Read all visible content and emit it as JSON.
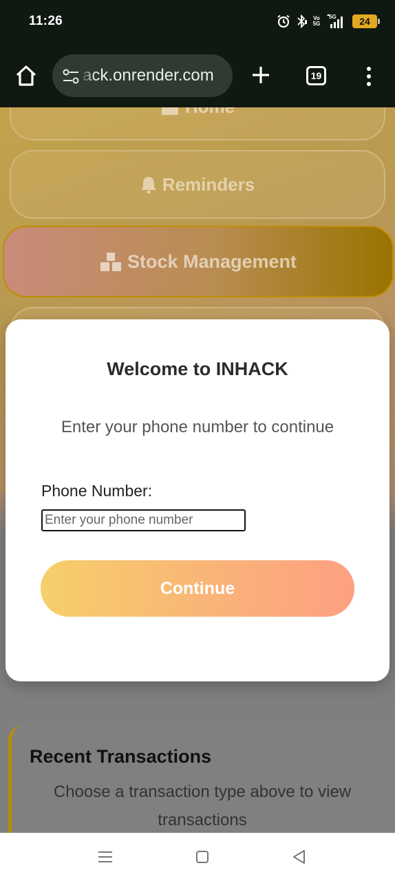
{
  "status_bar": {
    "time": "11:26",
    "network_label": "5G",
    "volte_label": "Vo 5G",
    "battery_level": "24",
    "icons": [
      "alarm-icon",
      "bluetooth-icon",
      "volte-icon",
      "signal-icon",
      "battery-icon"
    ]
  },
  "browser": {
    "url": "ack.onrender.com",
    "tab_count": "19",
    "icons": [
      "home-icon",
      "tune-icon",
      "plus-icon",
      "tabs-icon",
      "more-vert-icon"
    ]
  },
  "page": {
    "nav": {
      "home": "Home",
      "reminders": "Reminders",
      "stock": "Stock Management"
    },
    "transactions": {
      "title": "Recent Transactions",
      "subtitle": "Choose a transaction type above to view transactions"
    }
  },
  "modal": {
    "title": "Welcome to INHACK",
    "subtitle": "Enter your phone number to continue",
    "phone_label": "Phone Number:",
    "phone_placeholder": "Enter your phone number",
    "phone_value": "",
    "continue_label": "Continue"
  },
  "colors": {
    "accent_gradient_start": "#f6cf6a",
    "accent_gradient_end": "#fda082",
    "stock_border": "#c08d00"
  }
}
